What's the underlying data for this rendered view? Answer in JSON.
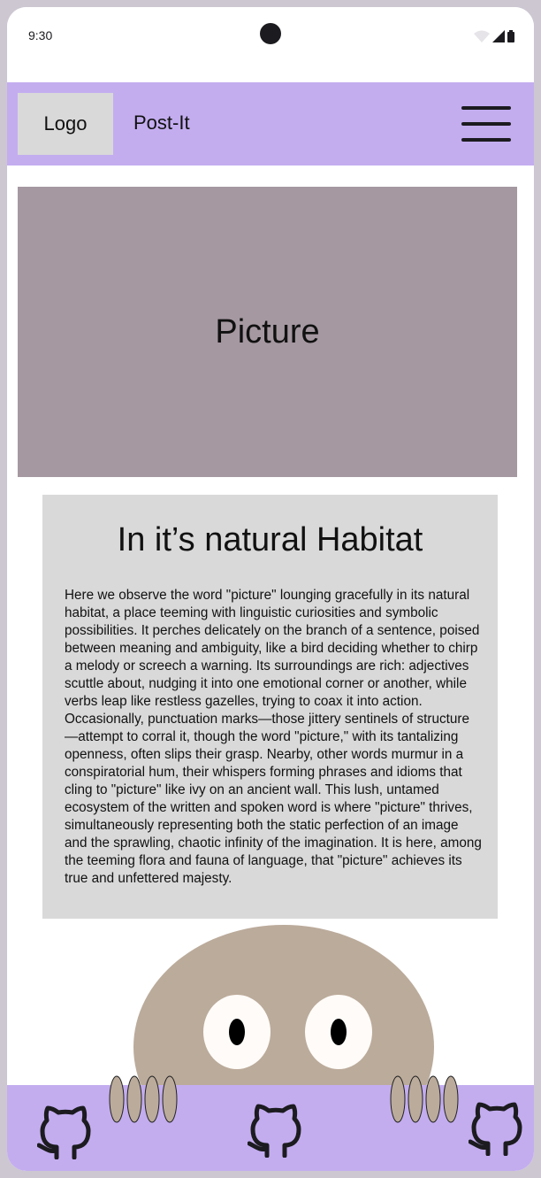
{
  "status_bar": {
    "time": "9:30",
    "icons": [
      "wifi-icon",
      "signal-icon",
      "battery-icon"
    ]
  },
  "header": {
    "logo_label": "Logo",
    "app_title": "Post-It",
    "menu_icon": "hamburger-menu-icon"
  },
  "picture": {
    "label": "Picture"
  },
  "article": {
    "title": "In it’s natural Habitat",
    "body": "Here we observe the word \"picture\" lounging gracefully in its natural habitat, a place teeming with linguistic curiosities and symbolic possibilities. It perches delicately on the branch of a sentence, poised between meaning and ambiguity, like a bird deciding whether to chirp a melody or screech a warning. Its surroundings are rich: adjectives scuttle about, nudging it into one emotional corner or another, while verbs leap like restless gazelles, trying to coax it into action. Occasionally, punctuation marks—those jittery sentinels of structure—attempt to corral it, though the word \"picture,\" with its tantalizing openness, often slips their grasp. Nearby, other words murmur in a conspiratorial hum, their whispers forming phrases and idioms that cling to \"picture\" like ivy on an ancient wall. This lush, untamed ecosystem of the written and spoken word is where \"picture\" thrives, simultaneously representing both the static perfection of an image and the sprawling, chaotic infinity of the imagination. It is here, among the teeming flora and fauna of language, that \"picture\" achieves its true and unfettered majesty."
  },
  "footer": {
    "links": [
      "github-icon",
      "github-icon",
      "github-icon"
    ]
  },
  "colors": {
    "accent": "#c3adef",
    "picture_bg": "#a598a1",
    "card_bg": "#d9d9d9",
    "mascot": "#bbab9b"
  }
}
